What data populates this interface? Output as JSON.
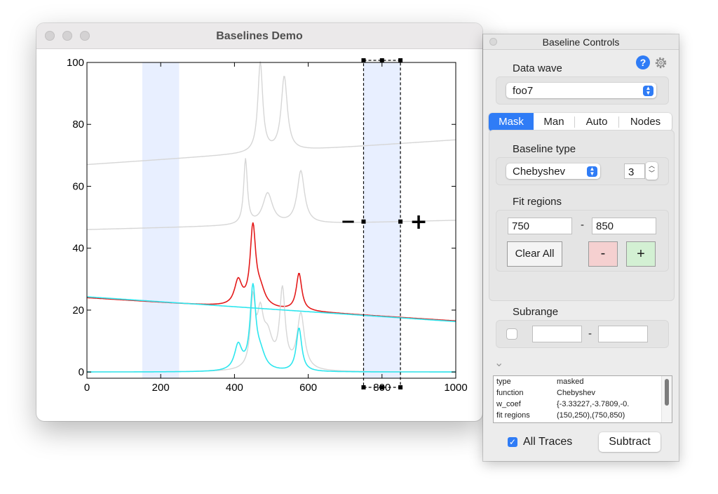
{
  "main_window": {
    "title": "Baselines Demo"
  },
  "plot": {
    "x_ticks": [
      "0",
      "200",
      "400",
      "600",
      "800",
      "1000"
    ],
    "y_ticks": [
      "0",
      "20",
      "40",
      "60",
      "80",
      "100"
    ],
    "minus_glyph": "−",
    "plus_glyph": "+"
  },
  "chart_data": {
    "type": "line",
    "xlim": [
      0,
      1000
    ],
    "ylim": [
      -2,
      100
    ],
    "grid": false,
    "masked_regions": [
      [
        150,
        250
      ],
      [
        750,
        850
      ]
    ],
    "colors": {
      "gray": "#d6d6d6",
      "red": "#e41a1a",
      "cyan": "#2ee6ee",
      "region": "#e8efff"
    },
    "series": [
      {
        "color": "#d6d6d6",
        "base_line": [
          [
            0,
            67
          ],
          [
            1000,
            75
          ]
        ],
        "peaks": [
          [
            470,
            29,
            8
          ],
          [
            535,
            24,
            10
          ]
        ]
      },
      {
        "color": "#d6d6d6",
        "base_line": [
          [
            0,
            46
          ],
          [
            1000,
            49
          ]
        ],
        "peaks": [
          [
            430,
            21,
            6
          ],
          [
            490,
            10,
            16
          ],
          [
            580,
            17,
            12
          ]
        ]
      },
      {
        "color": "#e41a1a",
        "base_line": [
          [
            0,
            24
          ],
          [
            1000,
            16.5
          ]
        ],
        "peaks": [
          [
            410,
            8,
            12
          ],
          [
            450,
            25,
            9
          ],
          [
            470,
            5,
            16
          ],
          [
            575,
            12,
            9
          ]
        ]
      },
      {
        "color": "#d6d6d6",
        "base_line": [
          [
            0,
            0
          ],
          [
            1000,
            0
          ]
        ],
        "peaks": [
          [
            450,
            21,
            8
          ],
          [
            470,
            15,
            10
          ],
          [
            490,
            10,
            16
          ],
          [
            530,
            25,
            9
          ],
          [
            580,
            18,
            12
          ]
        ]
      },
      {
        "color": "#2ee6ee",
        "base_line": [
          [
            0,
            0
          ],
          [
            1000,
            0
          ]
        ],
        "peaks": [
          [
            410,
            8,
            12
          ],
          [
            450,
            26,
            9
          ],
          [
            470,
            5,
            16
          ],
          [
            575,
            14,
            9
          ]
        ]
      },
      {
        "color": "#2ee6ee",
        "base_line": [
          [
            0,
            24.3
          ],
          [
            1000,
            16.3
          ]
        ],
        "peaks": []
      }
    ]
  },
  "panel": {
    "title": "Baseline Controls",
    "data_wave_label": "Data wave",
    "data_wave_value": "foo7",
    "tabs": [
      "Mask",
      "Man",
      "Auto",
      "Nodes"
    ],
    "baseline_type_label": "Baseline type",
    "baseline_type_value": "Chebyshev",
    "order_value": "3",
    "fit_regions_label": "Fit regions",
    "fit_from": "750",
    "fit_dash": "-",
    "fit_to": "850",
    "clear_all": "Clear All",
    "minus_label": "-",
    "plus_label": "+",
    "subrange_label": "Subrange",
    "subrange_dash": "-",
    "info_rows": [
      {
        "key": "type",
        "value": "masked"
      },
      {
        "key": "function",
        "value": "Chebyshev"
      },
      {
        "key": "w_coef",
        "value": "{-3.33227,-3.7809,-0."
      },
      {
        "key": "fit regions",
        "value": "(150,250),(750,850)"
      }
    ],
    "all_traces_label": "All Traces",
    "subtract_label": "Subtract",
    "help_glyph": "?",
    "chevron_glyph": "⌄",
    "colors": {
      "accent": "#2f7cf6",
      "minus_bg": "#f5d0d0",
      "plus_bg": "#d3f0d3"
    }
  }
}
